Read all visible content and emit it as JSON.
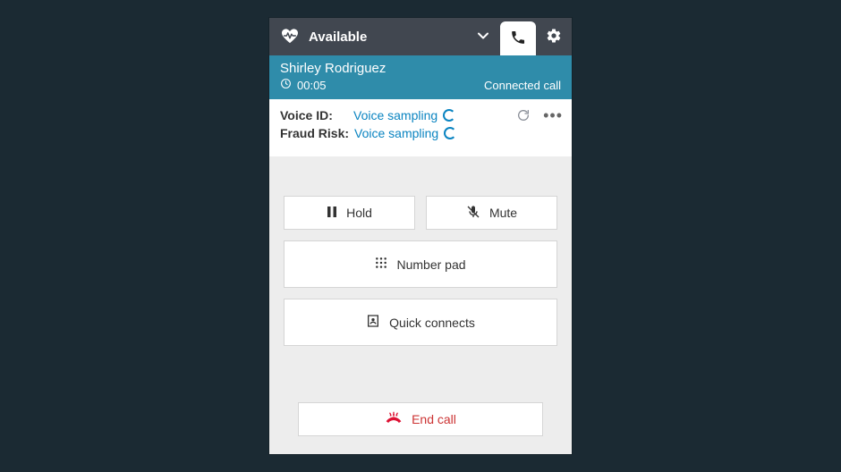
{
  "topbar": {
    "status_label": "Available"
  },
  "contact": {
    "name": "Shirley Rodriguez",
    "elapsed": "00:05",
    "state_label": "Connected call"
  },
  "voice": {
    "id_label": "Voice ID:",
    "id_value": "Voice sampling",
    "fraud_label": "Fraud Risk:",
    "fraud_value": "Voice sampling"
  },
  "buttons": {
    "hold": "Hold",
    "mute": "Mute",
    "numberpad": "Number pad",
    "quickconnects": "Quick connects",
    "endcall": "End call"
  }
}
